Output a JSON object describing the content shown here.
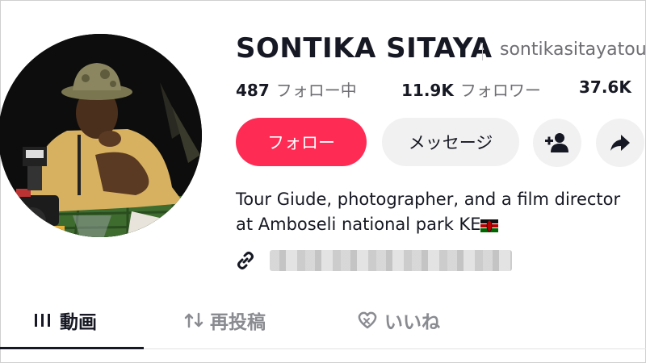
{
  "profile": {
    "name": "SONTIKA SITAYA",
    "handle": "sontikasitayatou",
    "stats": [
      {
        "value": "487",
        "label": "フォロー中"
      },
      {
        "value": "11.9K",
        "label": "フォロワー"
      },
      {
        "value": "37.6K",
        "label": ""
      }
    ],
    "bio_line1": "Tour Giude, photographer, and a film director",
    "bio_line2": "at Amboseli national park KE",
    "bio_flag_icon": "kenya-flag-icon"
  },
  "actions": {
    "follow_label": "フォロー",
    "message_label": "メッセージ",
    "add_friend_icon": "add-person-icon",
    "share_icon": "share-arrow-icon"
  },
  "tabs": [
    {
      "label": "動画",
      "icon": "grid-bars-icon",
      "active": true
    },
    {
      "label": "再投稿",
      "icon": "repost-icon",
      "active": false
    },
    {
      "label": "いいね",
      "icon": "heart-icon",
      "active": false
    }
  ],
  "colors": {
    "follow_button": "#fe2c55",
    "secondary_button": "#f1f1f2",
    "text_primary": "#161823",
    "text_secondary": "#6e6e73"
  }
}
